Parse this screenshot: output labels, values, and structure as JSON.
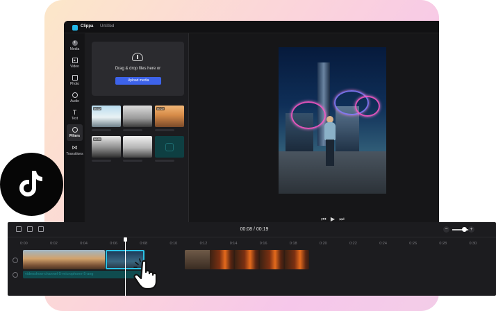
{
  "app": {
    "brand": "Clippa",
    "document_title": "Untitled"
  },
  "sidebar": {
    "items": [
      {
        "label": "Media",
        "icon": "plus-circle-icon"
      },
      {
        "label": "Video",
        "icon": "video-icon"
      },
      {
        "label": "Photo",
        "icon": "photo-icon"
      },
      {
        "label": "Audio",
        "icon": "audio-icon"
      },
      {
        "label": "Text",
        "icon": "text-icon"
      },
      {
        "label": "Filters",
        "icon": "filters-icon",
        "active": true
      },
      {
        "label": "Transitions",
        "icon": "transitions-icon"
      }
    ]
  },
  "media_panel": {
    "drop_text": "Drag & drop files here or",
    "upload_button": "Upload media",
    "thumbnails": [
      {
        "duration": "00:22"
      },
      {
        "duration": ""
      },
      {
        "duration": "00:22"
      },
      {
        "duration": "00:22"
      },
      {
        "duration": ""
      },
      {
        "duration": ""
      }
    ]
  },
  "timeline": {
    "current_time": "00:08 / 00:19",
    "ruler": [
      "0:00",
      "0:02",
      "0:04",
      "0:06",
      "0:08",
      "0:10",
      "0:12",
      "0:14",
      "0:16",
      "0:18",
      "0:20",
      "0:22",
      "0:24",
      "0:26",
      "0:28",
      "0:30"
    ],
    "audio_clip_label": "videoshow-channel-5-microphone-5-ang",
    "zoom": {
      "minus": "−",
      "plus": "+"
    }
  },
  "colors": {
    "accent": "#3d63ea",
    "selection": "#2bc3e6",
    "brand_cyan": "#23b7e8"
  }
}
